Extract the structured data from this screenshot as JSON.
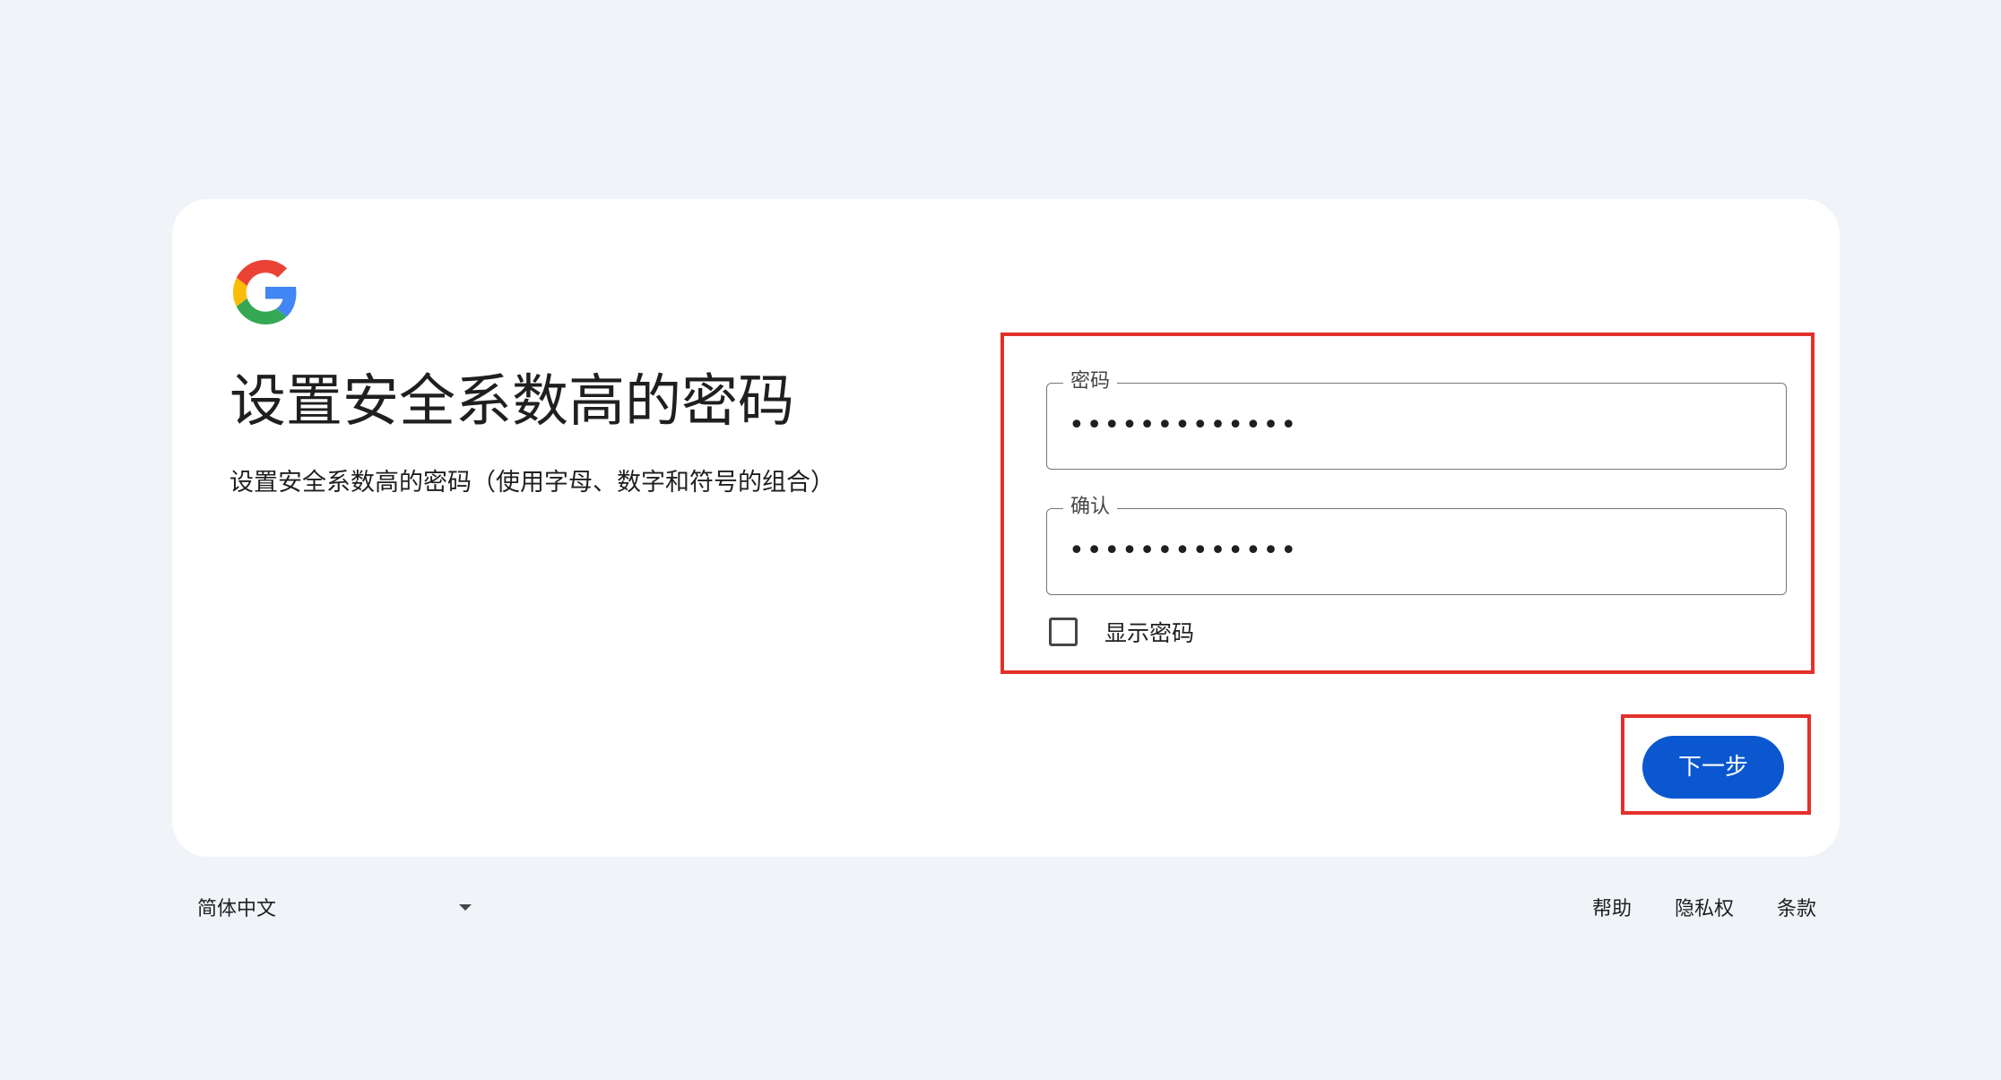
{
  "brand": {
    "logo_icon": "google-g-icon",
    "colors": {
      "blue": "#4285F4",
      "red": "#EA4335",
      "yellow": "#FBBC05",
      "green": "#34A853"
    }
  },
  "header": {
    "title": "设置安全系数高的密码",
    "subtitle": "设置安全系数高的密码（使用字母、数字和符号的组合）"
  },
  "form": {
    "password": {
      "label": "密码",
      "value": "•••••••••••••"
    },
    "confirm": {
      "label": "确认",
      "value": "•••••••••••••"
    },
    "show_password": {
      "label": "显示密码",
      "checked": false
    }
  },
  "actions": {
    "next_label": "下一步",
    "accent_color": "#0b57d0"
  },
  "annotation": {
    "highlight_color": "#e3302a"
  },
  "footer": {
    "language": "简体中文",
    "links": [
      "帮助",
      "隐私权",
      "条款"
    ]
  }
}
